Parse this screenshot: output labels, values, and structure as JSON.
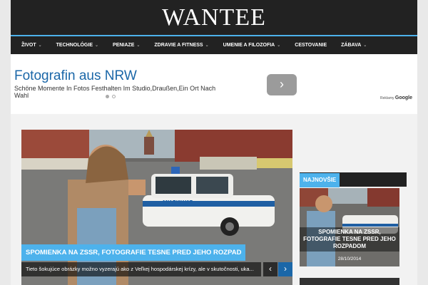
{
  "site": {
    "logo": "WANTEE"
  },
  "nav": {
    "items": [
      {
        "label": "ŽIVOT",
        "dropdown": true
      },
      {
        "label": "TECHNOLÓGIE",
        "dropdown": true
      },
      {
        "label": "PENIAZE",
        "dropdown": true
      },
      {
        "label": "ZDRAVIE A FITNESS",
        "dropdown": true
      },
      {
        "label": "UMENIE A FILOZOFIA",
        "dropdown": true
      },
      {
        "label": "CESTOVANIE",
        "dropdown": false
      },
      {
        "label": "ZÁBAVA",
        "dropdown": true
      }
    ]
  },
  "ad": {
    "title": "Fotografin aus NRW",
    "description": "Schöne Momente In Fotos Festhalten Im Studio,Draußen,Ein Ort Nach Wahl",
    "choices_label": "Reklamy",
    "choices_brand": "Google",
    "next_icon": "chevron-right-icon"
  },
  "slider": {
    "title": "SPOMIENKA NA ZSSR, FOTOGRAFIE TESNE PRED JEHO ROZPAD",
    "excerpt": "Tieto šokujúce obrázky možno vyzerajú ako z Veľkej hospodárskej krízy, ale v skutočnosti, uka...",
    "car_sign": "МИЛИЦИЯ",
    "prev_icon": "‹",
    "next_icon": "›"
  },
  "sidebar": {
    "heading": "NAJNOVŠIE",
    "card": {
      "title": "SPOMIENKA NA ZSSR, FOTOGRAFIE TESNE PRED JEHO ROZPADOM",
      "date": "28/10/2014"
    }
  },
  "colors": {
    "accent": "#4db2ec",
    "header": "#222222",
    "ad_link": "#1b67a8"
  }
}
